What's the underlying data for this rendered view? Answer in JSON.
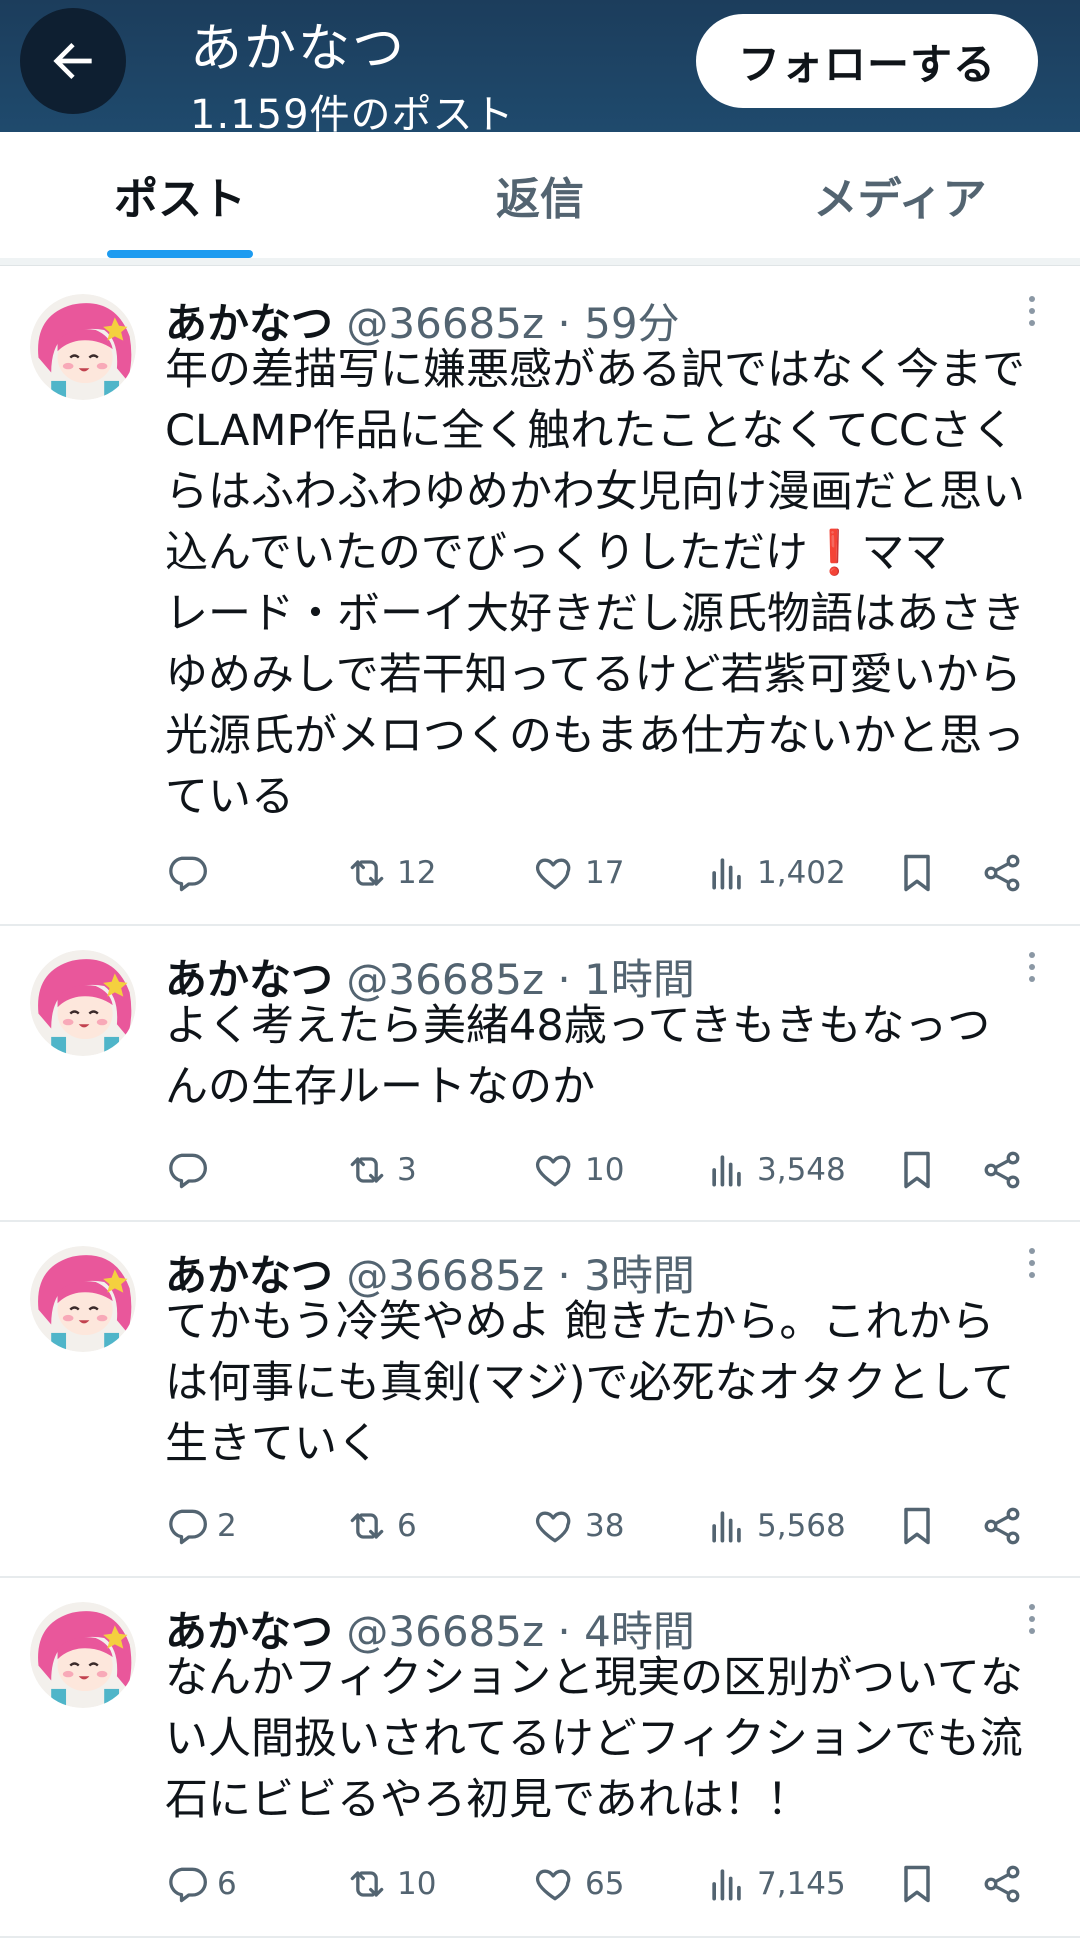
{
  "header": {
    "title": "あかなつ",
    "subtitle": "1.159件のポスト",
    "follow_label": "フォローする"
  },
  "tabs": [
    {
      "label": "ポスト",
      "active": true
    },
    {
      "label": "返信",
      "active": false
    },
    {
      "label": "メディア",
      "active": false
    }
  ],
  "posts": [
    {
      "name": "あかなつ",
      "handle": "@36685z",
      "time": "59分",
      "text": "年の差描写に嫌悪感がある訳ではなく今まで\nCLAMP作品に全く触れたことなくてCCさく\nらはふわふわゆめかわ女児向け漫画だと思い\n込んでいたのでびっくりしただけ❗️ママ\nレード・ボーイ大好きだし源氏物語はあさき\nゆめみしで若干知ってるけど若紫可愛いから\n光源氏がメロつくのもまあ仕方ないかと思っ\nている",
      "replies": "",
      "reposts": "12",
      "likes": "17",
      "views": "1,402"
    },
    {
      "name": "あかなつ",
      "handle": "@36685z",
      "time": "1時間",
      "text": "よく考えたら美緒48歳ってきもきもなっつ\nんの生存ルートなのか",
      "replies": "",
      "reposts": "3",
      "likes": "10",
      "views": "3,548"
    },
    {
      "name": "あかなつ",
      "handle": "@36685z",
      "time": "3時間",
      "text": "てかもう冷笑やめよ 飽きたから。これから\nは何事にも真剣(マジ)で必死なオタクとして\n生きていく",
      "replies": "2",
      "reposts": "6",
      "likes": "38",
      "views": "5,568"
    },
    {
      "name": "あかなつ",
      "handle": "@36685z",
      "time": "4時間",
      "text": "なんかフィクションと現実の区別がついてな\nい人間扱いされてるけどフィクションでも流\n石にビビるやろ初見であれは！！",
      "replies": "6",
      "reposts": "10",
      "likes": "65",
      "views": "7,145"
    }
  ],
  "meta_separator": " · ",
  "colors": {
    "header_bg": "#1f4a6d",
    "accent": "#1d9bf0",
    "text_primary": "#0f1419",
    "text_secondary": "#536471",
    "avatar_hair": "#e9579b"
  },
  "icons": {
    "back": "arrow-left-icon",
    "reply": "reply-icon",
    "repost": "repost-icon",
    "like": "heart-icon",
    "views": "views-icon",
    "bookmark": "bookmark-icon",
    "share": "share-icon",
    "more": "more-icon"
  }
}
